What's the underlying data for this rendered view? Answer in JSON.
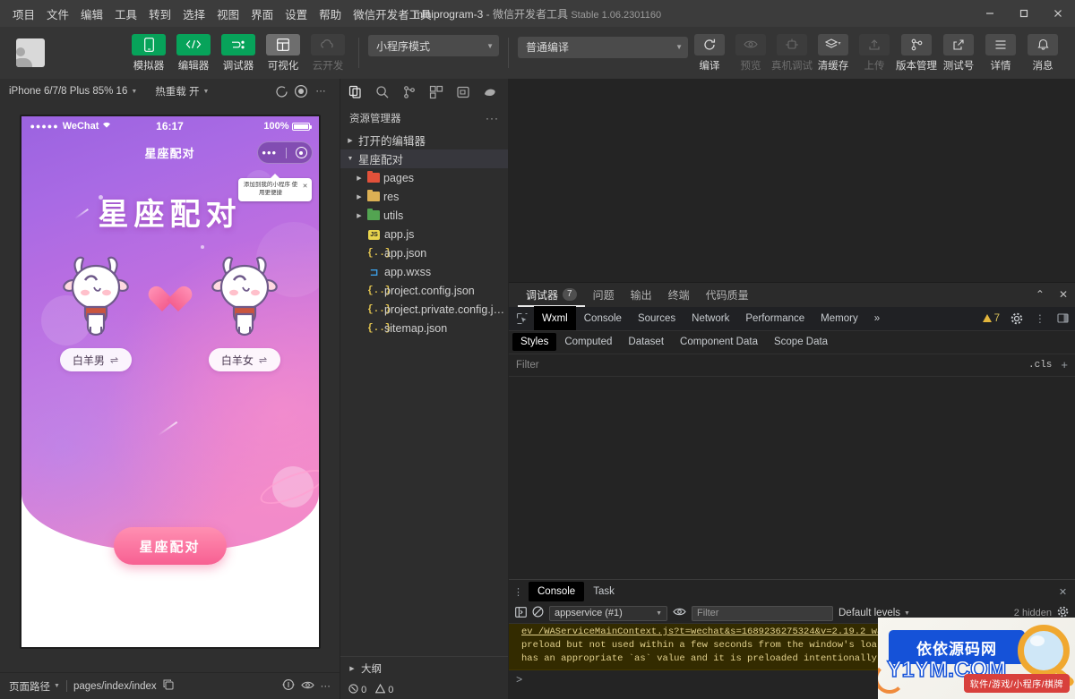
{
  "window": {
    "title_project": "miniprogram-3",
    "title_sep": "-",
    "title_app": "微信开发者工具",
    "title_version": "Stable 1.06.2301160",
    "minimize": "—",
    "maximize": "▢",
    "close": "✕"
  },
  "menubar": {
    "items": [
      "项目",
      "文件",
      "编辑",
      "工具",
      "转到",
      "选择",
      "视图",
      "界面",
      "设置",
      "帮助",
      "微信开发者工具"
    ]
  },
  "toolbar": {
    "left_buttons": [
      {
        "label": "模拟器",
        "icon": "phone-icon",
        "state": "active"
      },
      {
        "label": "编辑器",
        "icon": "code-icon",
        "state": "active"
      },
      {
        "label": "调试器",
        "icon": "debug-icon",
        "state": "active"
      },
      {
        "label": "可视化",
        "icon": "layout-icon",
        "state": "inactive"
      },
      {
        "label": "云开发",
        "icon": "cloud-icon",
        "state": "disabled"
      }
    ],
    "mode_select": "小程序模式",
    "compile_select": "普通编译",
    "action_buttons": [
      {
        "label": "编译",
        "icon": "refresh-icon",
        "state": "enabled"
      },
      {
        "label": "预览",
        "icon": "eye-icon",
        "state": "disabled"
      },
      {
        "label": "真机调试",
        "icon": "device-debug-icon",
        "state": "disabled"
      },
      {
        "label": "清缓存",
        "icon": "layers-icon",
        "state": "enabled"
      }
    ],
    "right_buttons": [
      {
        "label": "上传",
        "icon": "upload-icon",
        "state": "disabled"
      },
      {
        "label": "版本管理",
        "icon": "branch-icon",
        "state": "enabled"
      },
      {
        "label": "测试号",
        "icon": "external-link-icon",
        "state": "enabled"
      },
      {
        "label": "详情",
        "icon": "menu-icon",
        "state": "enabled"
      },
      {
        "label": "消息",
        "icon": "bell-icon",
        "state": "enabled"
      }
    ]
  },
  "simulator": {
    "device": "iPhone 6/7/8 Plus 85% 16",
    "hot_reload": "热重载 开",
    "footer": {
      "path_label": "页面路径",
      "path_value": "pages/index/index"
    },
    "phone": {
      "carrier": "WeChat",
      "signal_dots": "●●●●●",
      "time": "16:17",
      "battery": "100%",
      "nav_title": "星座配对",
      "tooltip": "添加到我的小程序 使用更便捷",
      "tooltip_close": "✕",
      "hero_title": "星座配对",
      "left_pick": "白羊男",
      "right_pick": "白羊女",
      "swap_icon": "⇌",
      "cta": "星座配对"
    }
  },
  "explorer": {
    "panel_title": "资源管理器",
    "more": "···",
    "open_editors": "打开的编辑器",
    "project_root": "星座配对",
    "tree": [
      {
        "name": "pages",
        "type": "folder",
        "color": "f-red"
      },
      {
        "name": "res",
        "type": "folder",
        "color": "f-yel"
      },
      {
        "name": "utils",
        "type": "folder",
        "color": "f-grn"
      },
      {
        "name": "app.js",
        "type": "js"
      },
      {
        "name": "app.json",
        "type": "json"
      },
      {
        "name": "app.wxss",
        "type": "wxss"
      },
      {
        "name": "project.config.json",
        "type": "json"
      },
      {
        "name": "project.private.config.js...",
        "type": "json"
      },
      {
        "name": "sitemap.json",
        "type": "json"
      }
    ],
    "outline": "大纲",
    "errors": "0",
    "warnings": "0"
  },
  "devtools": {
    "panel_tabs": [
      {
        "label": "调试器",
        "badge": "7",
        "active": true
      },
      {
        "label": "问题",
        "active": false
      },
      {
        "label": "输出",
        "active": false
      },
      {
        "label": "终端",
        "active": false
      },
      {
        "label": "代码质量",
        "active": false
      }
    ],
    "collapse_icon": "⌃",
    "close_icon": "✕",
    "chrome_tabs": [
      {
        "label": "Wxml",
        "active": true
      },
      {
        "label": "Console",
        "active": false
      },
      {
        "label": "Sources",
        "active": false
      },
      {
        "label": "Network",
        "active": false
      },
      {
        "label": "Performance",
        "active": false
      },
      {
        "label": "Memory",
        "active": false
      }
    ],
    "overflow": "»",
    "warning_count": "7",
    "styles_tabs": [
      {
        "label": "Styles",
        "active": true
      },
      {
        "label": "Computed",
        "active": false
      },
      {
        "label": "Dataset",
        "active": false
      },
      {
        "label": "Component Data",
        "active": false
      },
      {
        "label": "Scope Data",
        "active": false
      }
    ],
    "filter_placeholder": "Filter",
    "cls_label": ".cls",
    "plus": "+",
    "drawer": {
      "tabs": [
        {
          "label": "Console",
          "active": true
        },
        {
          "label": "Task",
          "active": false
        }
      ],
      "context": "appservice (#1)",
      "filter_placeholder": "Filter",
      "levels": "Default levels",
      "hidden": "2 hidden",
      "messages": [
        "ev  /WAServiceMainContext.js?t=wechat&s=1689236275324&v=2.19.2 was preloaded using link",
        "preload but not used within a few seconds from the window's loa",
        "has an appropriate `as` value and it is preloaded intentionally"
      ],
      "prompt": ">"
    }
  },
  "watermark": {
    "brand_cn": "依依源码网",
    "brand_domain": "Y1YM.COM",
    "tagline": "软件/游戏/小程序/棋牌"
  }
}
